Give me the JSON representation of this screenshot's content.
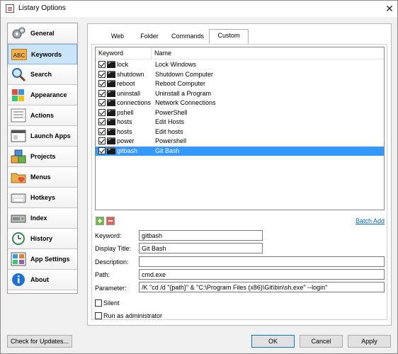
{
  "window": {
    "title": "Listary Options",
    "close_glyph": "✕"
  },
  "sidebar": {
    "items": [
      {
        "label": "General",
        "icon": "gears-icon"
      },
      {
        "label": "Keywords",
        "icon": "abc-icon"
      },
      {
        "label": "Search",
        "icon": "magnifier-icon"
      },
      {
        "label": "Appearance",
        "icon": "palette-icon"
      },
      {
        "label": "Actions",
        "icon": "actions-list-icon"
      },
      {
        "label": "Launch Apps",
        "icon": "launch-apps-icon"
      },
      {
        "label": "Projects",
        "icon": "boxes-icon"
      },
      {
        "label": "Menus",
        "icon": "heart-folder-icon"
      },
      {
        "label": "Hotkeys",
        "icon": "keyboard-icon"
      },
      {
        "label": "Index",
        "icon": "index-drive-icon"
      },
      {
        "label": "History",
        "icon": "clock-icon"
      },
      {
        "label": "App Settings",
        "icon": "app-grid-icon"
      },
      {
        "label": "About",
        "icon": "info-icon"
      }
    ],
    "active_index": 1
  },
  "tabs": [
    {
      "label": "Web"
    },
    {
      "label": "Folder"
    },
    {
      "label": "Commands"
    },
    {
      "label": "Custom"
    }
  ],
  "active_tab": "Custom",
  "list": {
    "columns": [
      "Keyword",
      "Name"
    ],
    "rows": [
      {
        "keyword": "lock",
        "name": "Lock Windows",
        "checked": true
      },
      {
        "keyword": "shutdown",
        "name": "Shutdown Computer",
        "checked": true
      },
      {
        "keyword": "reboot",
        "name": "Reboot Computer",
        "checked": true
      },
      {
        "keyword": "uninstall",
        "name": "Uninstall a Program",
        "checked": true
      },
      {
        "keyword": "connections",
        "name": "Network Connections",
        "checked": true
      },
      {
        "keyword": "pshell",
        "name": "PowerShell",
        "checked": true
      },
      {
        "keyword": "hosts",
        "name": "Edit Hosts",
        "checked": true
      },
      {
        "keyword": "hosts",
        "name": "Edit hosts",
        "checked": true
      },
      {
        "keyword": "power",
        "name": "Powershell",
        "checked": true
      },
      {
        "keyword": "gitbash",
        "name": "Git Bash",
        "checked": true
      }
    ],
    "selected_index": 9
  },
  "batch_add_label": "Batch Add",
  "form": {
    "keyword_label": "Keyword:",
    "keyword_value": "gitbash",
    "display_title_label": "Display Title:",
    "display_title_value": "Git Bash",
    "description_label": "Description:",
    "description_value": "",
    "path_label": "Path:",
    "path_value": "cmd.exe",
    "parameter_label": "Parameter:",
    "parameter_value": "/K \"cd /d \"{path}\" & \"C:\\Program Files (x86)\\Git\\bin\\sh.exe\" --login\""
  },
  "options": {
    "silent_label": "Silent",
    "silent_checked": false,
    "run_admin_label": "Run as administrator",
    "run_admin_checked": false
  },
  "footer": {
    "check_updates_label": "Check for Updates...",
    "ok_label": "OK",
    "cancel_label": "Cancel",
    "apply_label": "Apply"
  },
  "colors": {
    "selection": "#3399ff",
    "active_nav": "#cce4f7",
    "link": "#0066cc"
  }
}
